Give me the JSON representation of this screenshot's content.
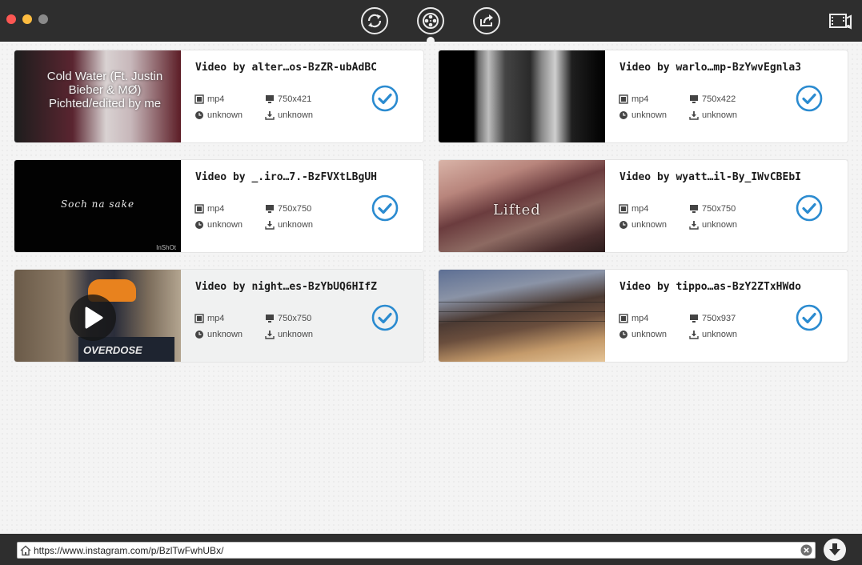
{
  "toolbar": {
    "buttons": [
      {
        "name": "convert",
        "icon": "refresh-circle-icon"
      },
      {
        "name": "download",
        "icon": "film-reel-icon"
      },
      {
        "name": "share",
        "icon": "share-icon"
      }
    ],
    "right_icon": "media-library-icon"
  },
  "videos": [
    {
      "title": "Video by alter…os-BzZR-ubAdBC",
      "format": "mp4",
      "resolution": "750x421",
      "duration": "unknown",
      "size": "unknown",
      "thumb_text": "Cold Water (Ft. Justin Bieber & MØ) Pichted/edited by me",
      "checked": true
    },
    {
      "title": "Video by warlo…mp-BzYwvEgnla3",
      "format": "mp4",
      "resolution": "750x422",
      "duration": "unknown",
      "size": "unknown",
      "checked": true
    },
    {
      "title": "Video by _.iro…7.-BzFVXtLBgUH",
      "format": "mp4",
      "resolution": "750x750",
      "duration": "unknown",
      "size": "unknown",
      "thumb_text": "Soch na sake",
      "thumb_badge": "InShOt",
      "checked": true
    },
    {
      "title": "Video by wyatt…il-By_IWvCBEbI",
      "format": "mp4",
      "resolution": "750x750",
      "duration": "unknown",
      "size": "unknown",
      "thumb_text": "Lifted",
      "checked": true
    },
    {
      "title": "Video by night…es-BzYbUQ6HIfZ",
      "format": "mp4",
      "resolution": "750x750",
      "duration": "unknown",
      "size": "unknown",
      "thumb_text": "OVERDOSE",
      "selected": true,
      "checked": true
    },
    {
      "title": "Video by tippo…as-BzY2ZTxHWdo",
      "format": "mp4",
      "resolution": "750x937",
      "duration": "unknown",
      "size": "unknown",
      "checked": true
    }
  ],
  "url_bar": {
    "value": "https://www.instagram.com/p/BzlTwFwhUBx/"
  },
  "colors": {
    "accent": "#2b8bd0",
    "titlebar": "#2e2e2e"
  }
}
